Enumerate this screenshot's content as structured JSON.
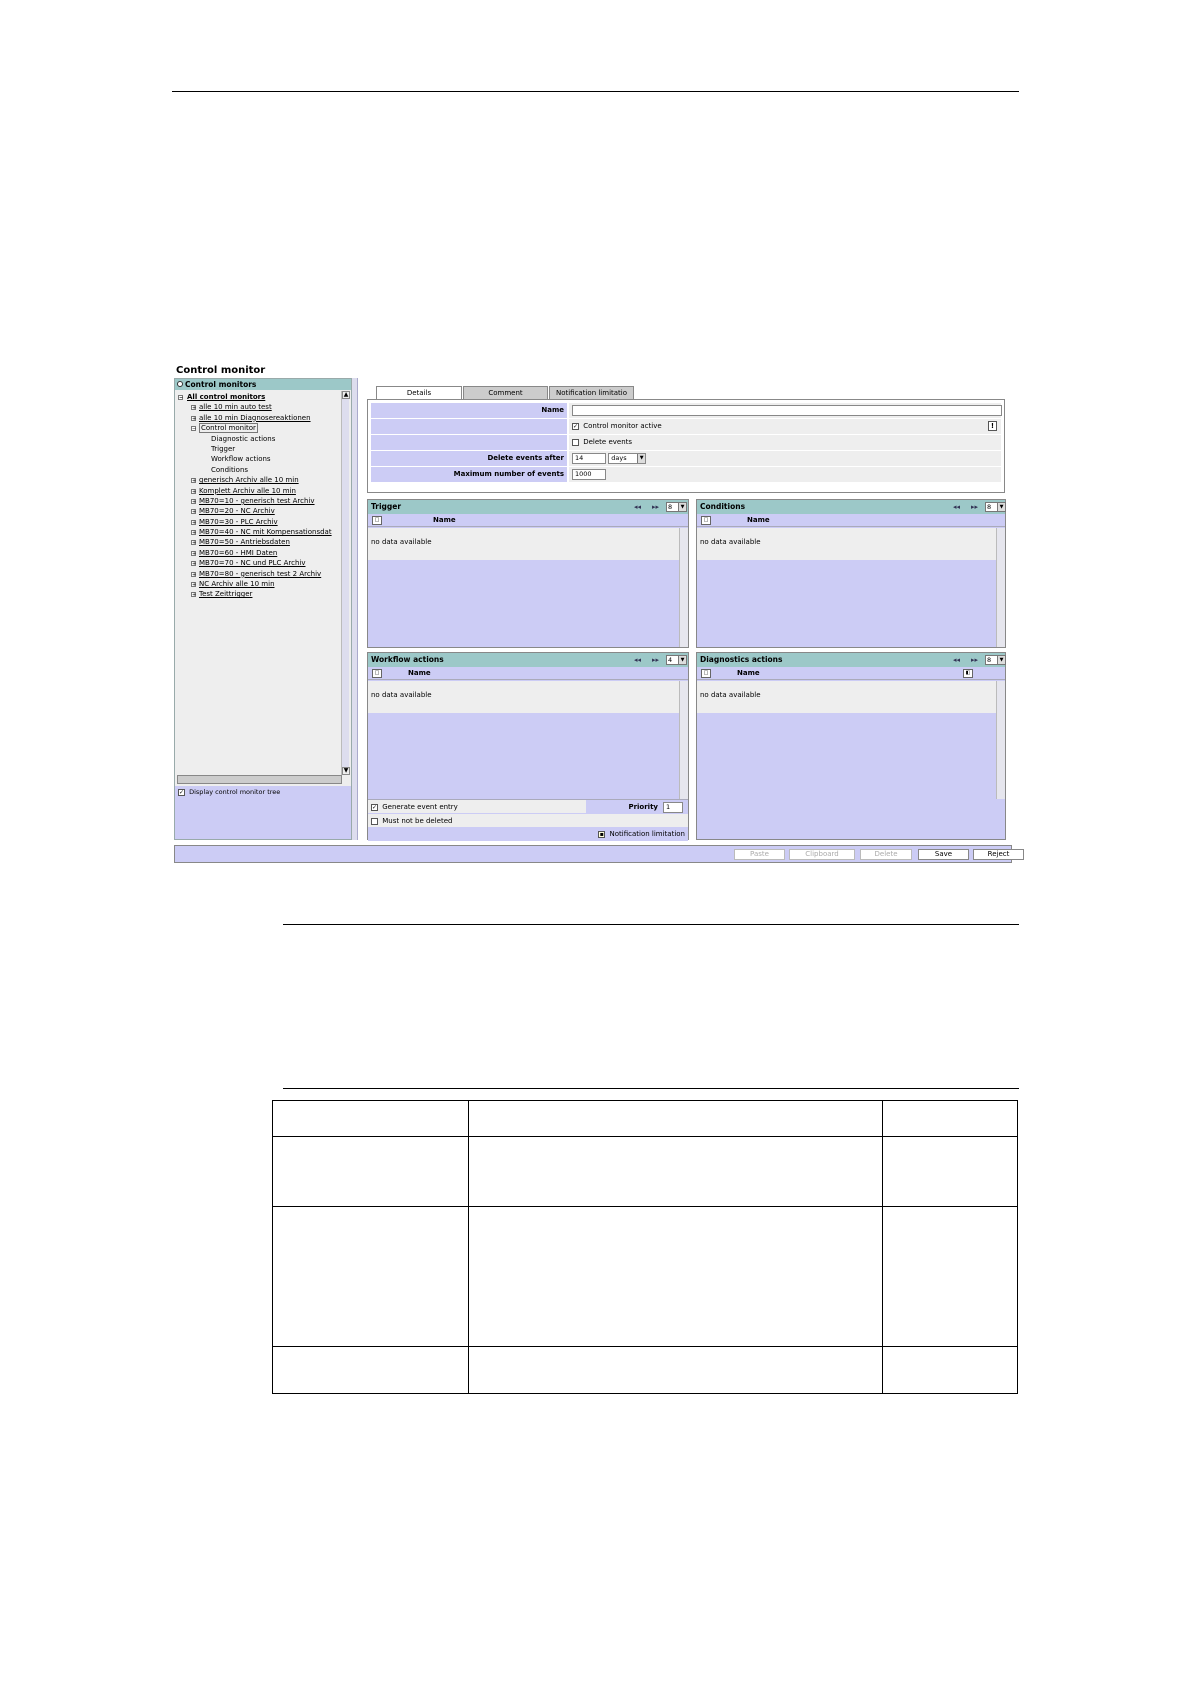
{
  "app_title": "Control monitor",
  "sidebar": {
    "header": "Control monitors",
    "tree_root": "All control monitors",
    "items": [
      {
        "label": "alle 10 min auto test",
        "level": 1,
        "expander": "+"
      },
      {
        "label": "alle 10 min Diagnosereaktionen",
        "level": 1,
        "expander": "+"
      },
      {
        "label": "Control monitor",
        "level": 1,
        "expander": "−",
        "selected": true
      },
      {
        "label": "Diagnostic actions",
        "level": 2
      },
      {
        "label": "Trigger",
        "level": 2
      },
      {
        "label": "Workflow actions",
        "level": 2
      },
      {
        "label": "Conditions",
        "level": 2
      },
      {
        "label": "generisch Archiv alle 10 min",
        "level": 1,
        "expander": "+"
      },
      {
        "label": "Komplett Archiv alle 10 min",
        "level": 1,
        "expander": "+"
      },
      {
        "label": "MB70=10 - generisch test Archiv",
        "level": 1,
        "expander": "+"
      },
      {
        "label": "MB70=20 - NC Archiv",
        "level": 1,
        "expander": "+"
      },
      {
        "label": "MB70=30 - PLC Archiv",
        "level": 1,
        "expander": "+"
      },
      {
        "label": "MB70=40 - NC mit Kompensationsdat",
        "level": 1,
        "expander": "+"
      },
      {
        "label": "MB70=50 - Antriebsdaten",
        "level": 1,
        "expander": "+"
      },
      {
        "label": "MB70=60 - HMI Daten",
        "level": 1,
        "expander": "+"
      },
      {
        "label": "MB70=70 - NC und PLC Archiv",
        "level": 1,
        "expander": "+"
      },
      {
        "label": "MB70=80 - generisch test 2 Archiv",
        "level": 1,
        "expander": "+"
      },
      {
        "label": "NC Archiv alle 10 min",
        "level": 1,
        "expander": "+"
      },
      {
        "label": "Test Zeittrigger",
        "level": 1,
        "expander": "+"
      }
    ],
    "footer_checkbox": "Display control monitor tree"
  },
  "tabs": [
    "Details",
    "Comment",
    "Notification limitatio"
  ],
  "details": {
    "name_label": "Name",
    "name_value": "",
    "active_label": "Control monitor active",
    "active_checked": true,
    "delete_events_label": "Delete events",
    "delete_events_checked": false,
    "delete_after_label": "Delete events after",
    "delete_after_value": "14",
    "delete_after_unit": "days",
    "max_events_label": "Maximum number of events",
    "max_events_value": "1000",
    "info_icon": "!"
  },
  "panels": {
    "trigger": {
      "title": "Trigger",
      "count": "8",
      "column": "Name",
      "empty": "no data available"
    },
    "conditions": {
      "title": "Conditions",
      "count": "8",
      "column": "Name",
      "empty": "no data available"
    },
    "workflow": {
      "title": "Workflow actions",
      "count": "4",
      "column": "Name",
      "empty": "no data available"
    },
    "diagnostics": {
      "title": "Diagnostics actions",
      "count": "8",
      "column": "Name",
      "empty": "no data available"
    }
  },
  "workflow_footer": {
    "generate_label": "Generate event entry",
    "generate_checked": true,
    "priority_label": "Priority",
    "priority_value": "1",
    "must_not_delete_label": "Must not be deleted",
    "notification_label": "Notification limitation"
  },
  "buttons": {
    "paste": "Paste",
    "clipboard": "Clipboard",
    "delete": "Delete",
    "save": "Save",
    "reject": "Reject"
  },
  "icons": {
    "expander": "tree-expander-icon",
    "new_doc": "new-document-icon",
    "first": "first-page-icon",
    "next": "next-page-icon"
  },
  "colors": {
    "header_teal": "#9cc8c8",
    "panel_lavender": "#ccccf5",
    "row_gray": "#eeeeee"
  }
}
